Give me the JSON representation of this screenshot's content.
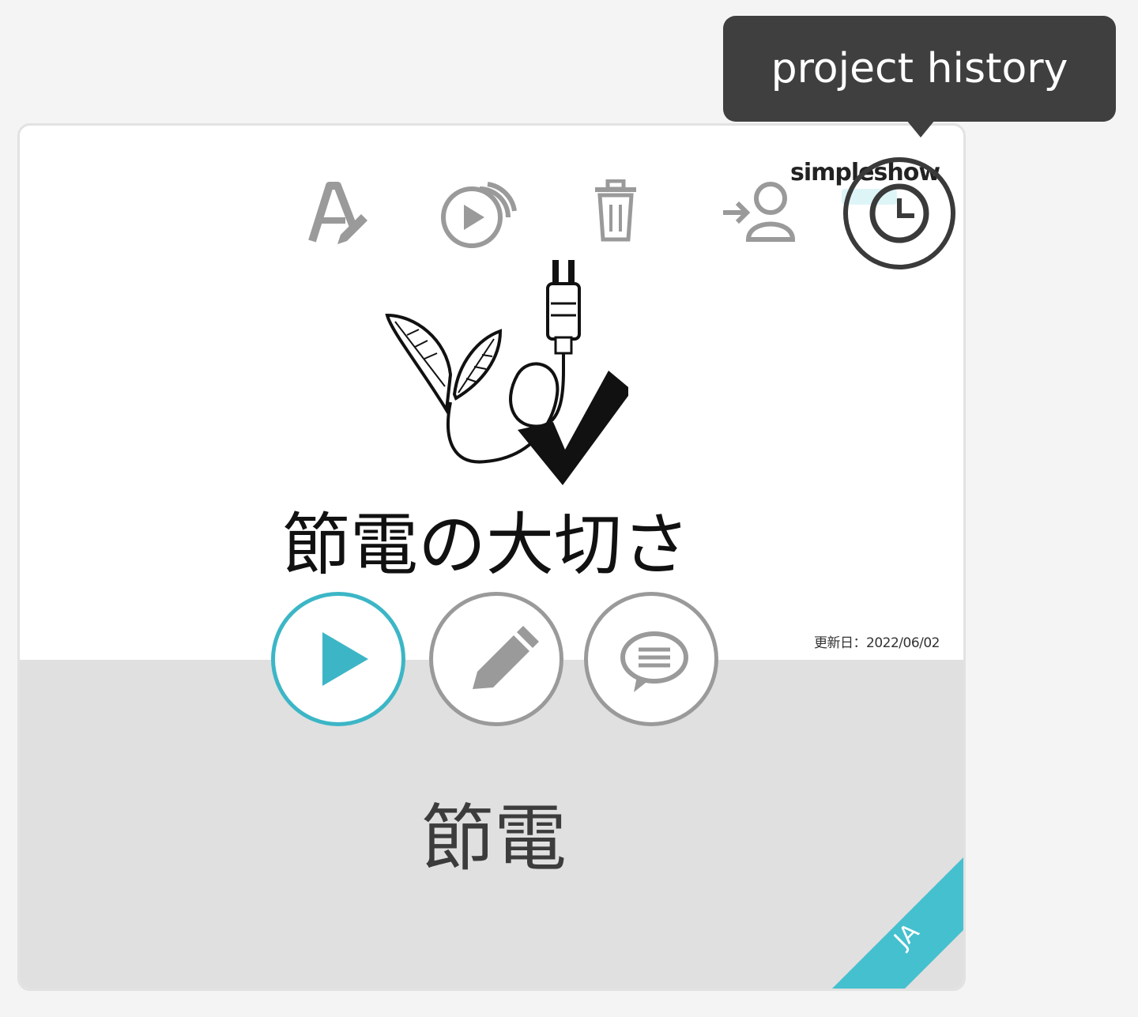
{
  "card": {
    "slide_title": "節電の大切さ",
    "project_name": "節電",
    "date": "更新日：2022/06/02",
    "language_badge": "JA",
    "brand_logo": "simpleshow",
    "illustration": "leaf-plug-checkmark-illustration"
  },
  "toolbar": {
    "icons": [
      "rename-icon",
      "presentations-icon",
      "trash-icon",
      "share-user-icon",
      "history-clock-icon"
    ]
  },
  "actions": {
    "buttons": [
      "play-button",
      "edit-button",
      "comment-button"
    ]
  },
  "tooltip": {
    "text": "project history"
  },
  "colors": {
    "accent": "#3cb6c6",
    "icon_gray": "#9a9a9a",
    "tooltip_bg": "#3f3f3f",
    "bottom_bg": "#e0e0e0"
  }
}
